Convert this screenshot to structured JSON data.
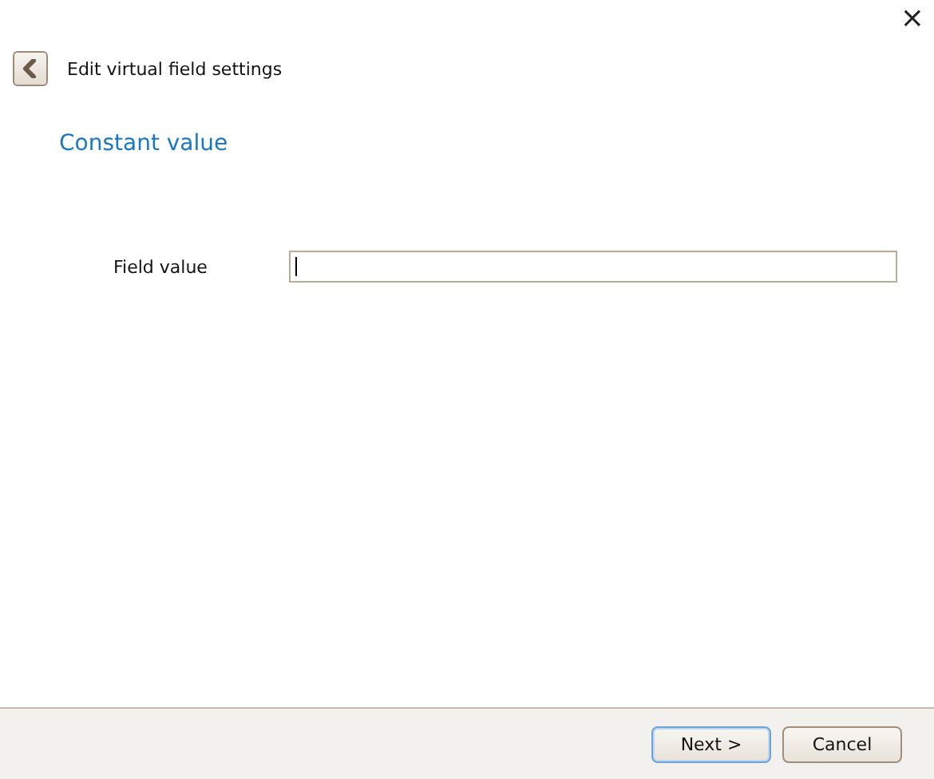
{
  "window": {
    "close": "×"
  },
  "header": {
    "title": "Edit virtual field settings"
  },
  "section": {
    "heading": "Constant value"
  },
  "fields": [
    {
      "label": "Field value",
      "focused": true
    }
  ],
  "buttons": [
    {
      "label": "Next >",
      "default": true
    },
    {
      "label": "Cancel",
      "default": false
    }
  ]
}
